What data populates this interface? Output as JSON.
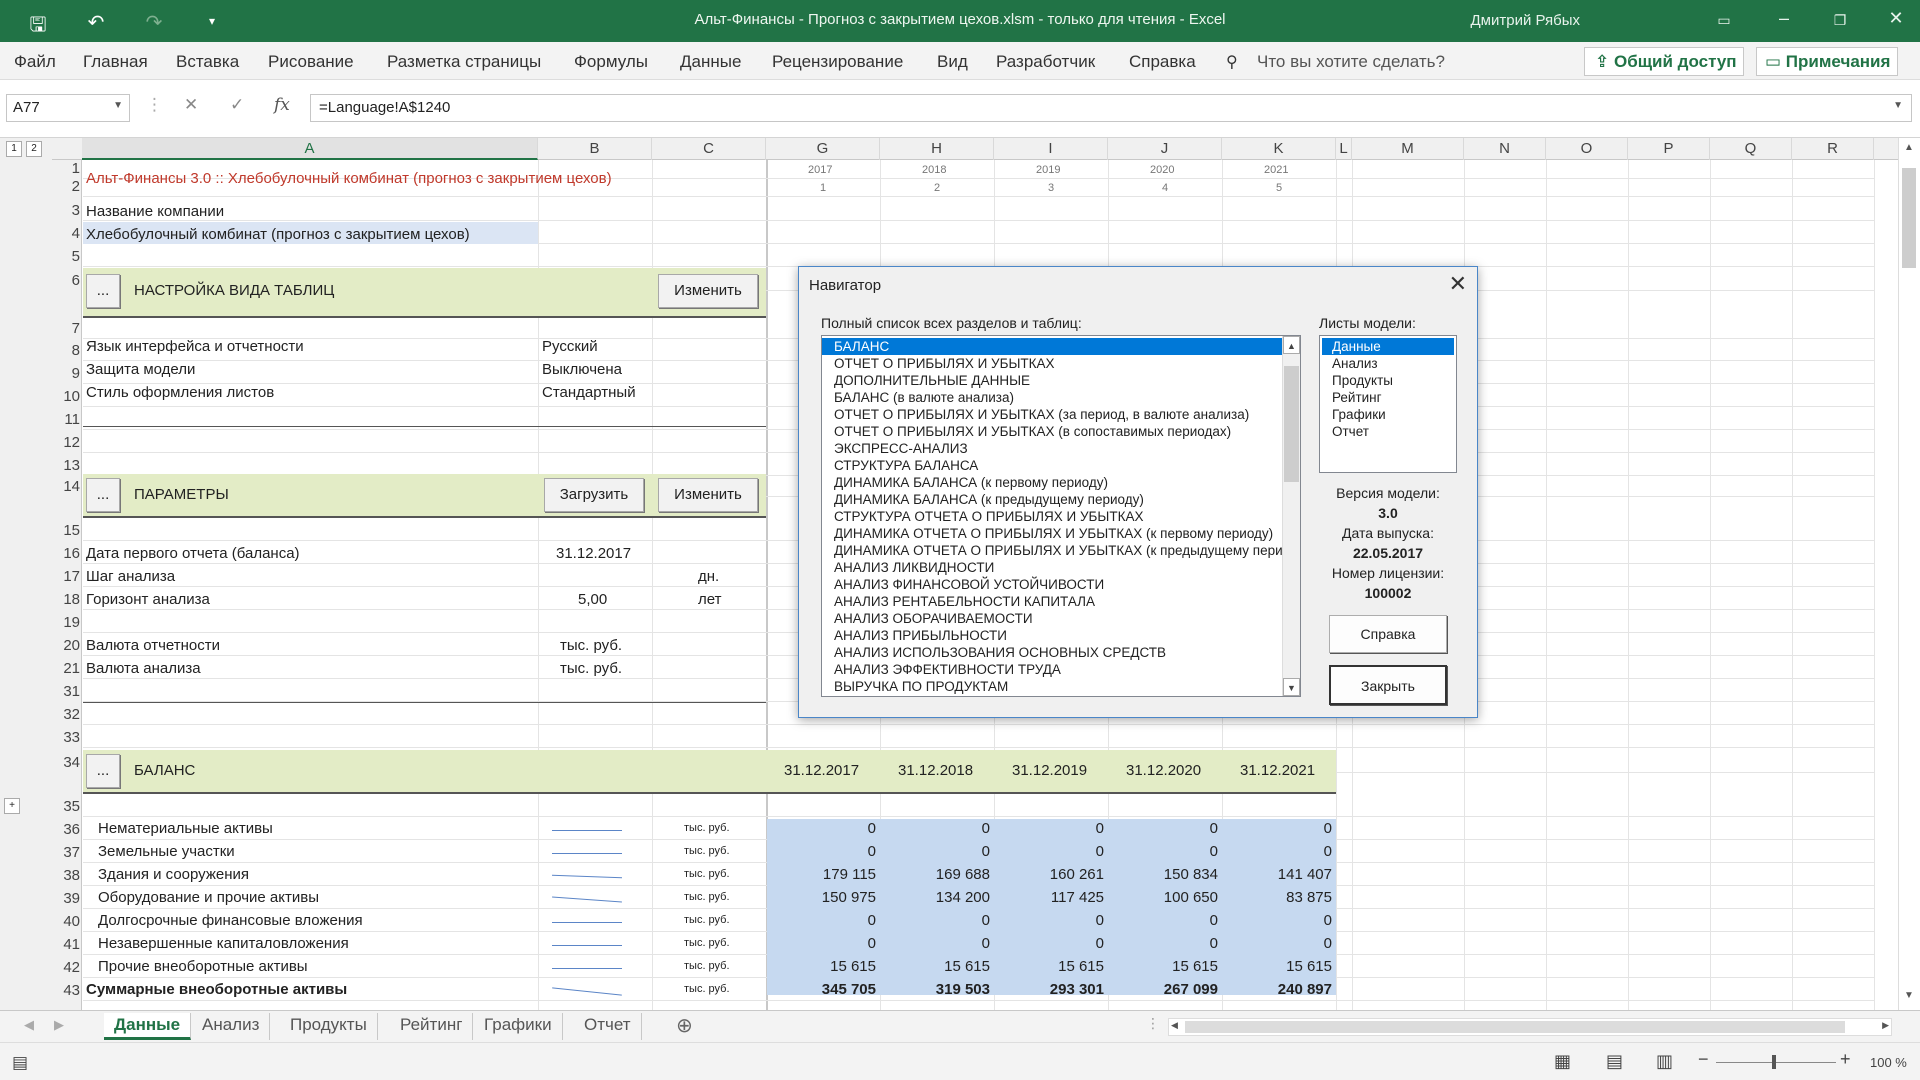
{
  "window": {
    "title": "Альт-Финансы - Прогноз с закрытием цехов.xlsm  -  только для чтения  -  Excel",
    "user": "Дмитрий Рябых"
  },
  "menu": {
    "items": [
      "Файл",
      "Главная",
      "Вставка",
      "Рисование",
      "Разметка страницы",
      "Формулы",
      "Данные",
      "Рецензирование",
      "Вид",
      "Разработчик",
      "Справка"
    ],
    "tell": "Что вы хотите сделать?",
    "share": "Общий доступ",
    "comments": "Примечания"
  },
  "formula_bar": {
    "name_box": "A77",
    "fx": "fx",
    "formula": "=Language!A$1240"
  },
  "columns": [
    "A",
    "B",
    "C",
    "G",
    "H",
    "I",
    "J",
    "K",
    "L",
    "M",
    "N",
    "O",
    "P",
    "Q",
    "R"
  ],
  "outline": {
    "levels": [
      "1",
      "2"
    ],
    "expand": "+"
  },
  "years": {
    "y": [
      "2017",
      "2018",
      "2019",
      "2020",
      "2021"
    ],
    "n": [
      "1",
      "2",
      "3",
      "4",
      "5"
    ]
  },
  "rows": [
    "1",
    "2",
    "3",
    "4",
    "5",
    "6",
    "7",
    "8",
    "9",
    "10",
    "11",
    "12",
    "13",
    "14",
    "15",
    "16",
    "17",
    "18",
    "19",
    "20",
    "21",
    "31",
    "32",
    "33",
    "34",
    "35",
    "36",
    "37",
    "38",
    "39",
    "40",
    "41",
    "42",
    "43"
  ],
  "cells": {
    "r1": "Альт-Финансы 3.0 :: Хлебобулочный комбинат (прогноз с закрытием цехов)",
    "r3": "Название компании",
    "r4": "Хлебобулочный комбинат (прогноз с закрытием цехов)",
    "sect6": "НАСТРОЙКА ВИДА ТАБЛИЦ",
    "dots": "...",
    "change": "Изменить",
    "load": "Загрузить",
    "r8a": "Язык интерфейса и отчетности",
    "r8b": "Русский",
    "r9a": "Защита модели",
    "r9b": "Выключена",
    "r10a": "Стиль оформления листов",
    "r10b": "Стандартный",
    "sect14": "ПАРАМЕТРЫ",
    "r16a": "Дата первого отчета (баланса)",
    "r16b": "31.12.2017",
    "r17a": "Шаг анализа",
    "r17c": "дн.",
    "r18a": "Горизонт анализа",
    "r18b": "5,00",
    "r18c": "лет",
    "r20a": "Валюта отчетности",
    "r20b": "тыс. руб.",
    "r21a": "Валюта анализа",
    "r21b": "тыс. руб.",
    "sect34": "БАЛАНС",
    "dates": [
      "31.12.2017",
      "31.12.2018",
      "31.12.2019",
      "31.12.2020",
      "31.12.2021"
    ]
  },
  "balance": [
    {
      "label": "Нематериальные активы",
      "unit": "тыс. руб.",
      "values": [
        "0",
        "0",
        "0",
        "0",
        "0"
      ]
    },
    {
      "label": "Земельные участки",
      "unit": "тыс. руб.",
      "values": [
        "0",
        "0",
        "0",
        "0",
        "0"
      ]
    },
    {
      "label": "Здания и сооружения",
      "unit": "тыс. руб.",
      "values": [
        "179 115",
        "169 688",
        "160 261",
        "150 834",
        "141 407"
      ]
    },
    {
      "label": "Оборудование и прочие активы",
      "unit": "тыс. руб.",
      "values": [
        "150 975",
        "134 200",
        "117 425",
        "100 650",
        "83 875"
      ]
    },
    {
      "label": "Долгосрочные финансовые вложения",
      "unit": "тыс. руб.",
      "values": [
        "0",
        "0",
        "0",
        "0",
        "0"
      ]
    },
    {
      "label": "Незавершенные капиталовложения",
      "unit": "тыс. руб.",
      "values": [
        "0",
        "0",
        "0",
        "0",
        "0"
      ]
    },
    {
      "label": "Прочие внеоборотные активы",
      "unit": "тыс. руб.",
      "values": [
        "15 615",
        "15 615",
        "15 615",
        "15 615",
        "15 615"
      ]
    },
    {
      "label": "Суммарные внеоборотные активы",
      "unit": "тыс. руб.",
      "values": [
        "345 705",
        "319 503",
        "293 301",
        "267 099",
        "240 897"
      ],
      "bold": true
    }
  ],
  "dialog": {
    "title": "Навигатор",
    "list_label": "Полный список всех разделов и таблиц:",
    "sheets_label": "Листы модели:",
    "sections": [
      "БАЛАНС",
      "ОТЧЕТ О ПРИБЫЛЯХ И УБЫТКАХ",
      "ДОПОЛНИТЕЛЬНЫЕ ДАННЫЕ",
      "БАЛАНС (в валюте анализа)",
      "ОТЧЕТ О ПРИБЫЛЯХ И УБЫТКАХ (за период, в валюте анализа)",
      "ОТЧЕТ О ПРИБЫЛЯХ И УБЫТКАХ (в сопоставимых периодах)",
      "ЭКСПРЕСС-АНАЛИЗ",
      "СТРУКТУРА БАЛАНСА",
      "ДИНАМИКА БАЛАНСА (к первому периоду)",
      "ДИНАМИКА БАЛАНСА (к предыдущему периоду)",
      "СТРУКТУРА ОТЧЕТА О ПРИБЫЛЯХ И УБЫТКАХ",
      "ДИНАМИКА ОТЧЕТА О ПРИБЫЛЯХ И УБЫТКАХ (к первому периоду)",
      "ДИНАМИКА ОТЧЕТА О ПРИБЫЛЯХ И УБЫТКАХ (к предыдущему перио",
      "АНАЛИЗ ЛИКВИДНОСТИ",
      "АНАЛИЗ ФИНАНСОВОЙ УСТОЙЧИВОСТИ",
      "АНАЛИЗ РЕНТАБЕЛЬНОСТИ КАПИТАЛА",
      "АНАЛИЗ ОБОРАЧИВАЕМОСТИ",
      "АНАЛИЗ ПРИБЫЛЬНОСТИ",
      "АНАЛИЗ ИСПОЛЬЗОВАНИЯ ОСНОВНЫХ СРЕДСТВ",
      "АНАЛИЗ ЭФФЕКТИВНОСТИ ТРУДА",
      "ВЫРУЧКА ПО ПРОДУКТАМ"
    ],
    "sheets": [
      "Данные",
      "Анализ",
      "Продукты",
      "Рейтинг",
      "Графики",
      "Отчет"
    ],
    "version_label": "Версия модели:",
    "version": "3.0",
    "date_label": "Дата выпуска:",
    "date": "22.05.2017",
    "license_label": "Номер лицензии:",
    "license": "100002",
    "help": "Справка",
    "close": "Закрыть"
  },
  "tabs": [
    "Данные",
    "Анализ",
    "Продукты",
    "Рейтинг",
    "Графики",
    "Отчет"
  ],
  "status": {
    "zoom": "100 %"
  }
}
